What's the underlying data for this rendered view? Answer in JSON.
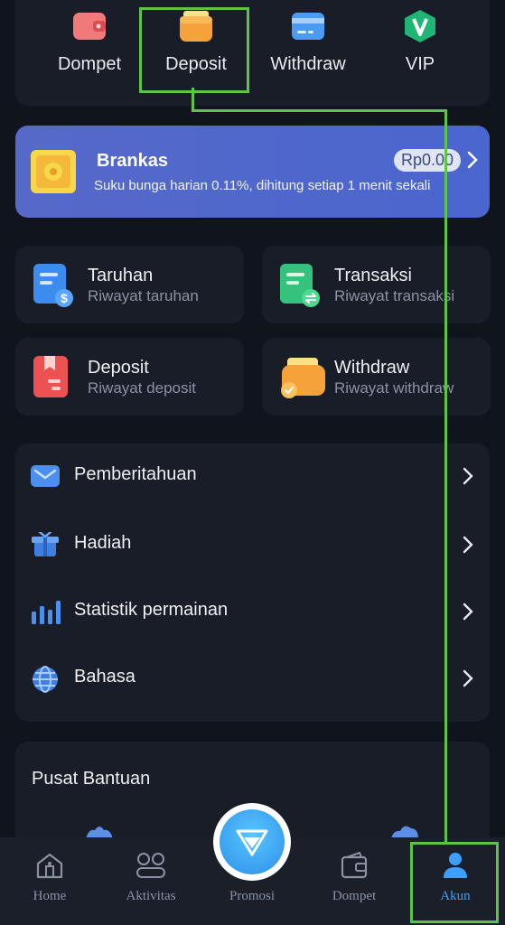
{
  "quick_actions": [
    {
      "label": "Dompet",
      "icon": "wallet-red-icon"
    },
    {
      "label": "Deposit",
      "icon": "wallet-orange-icon"
    },
    {
      "label": "Withdraw",
      "icon": "card-blue-icon"
    },
    {
      "label": "VIP",
      "icon": "vip-shield-icon"
    }
  ],
  "brankas": {
    "title": "Brankas",
    "subtitle": "Suku bunga harian 0.11%, dihitung setiap 1 menit sekali",
    "amount": "Rp0.00"
  },
  "history": [
    {
      "title": "Taruhan",
      "subtitle": "Riwayat taruhan",
      "icon": "bet-document-icon",
      "color": "#3c8cf0"
    },
    {
      "title": "Transaksi",
      "subtitle": "Riwayat transaksi",
      "icon": "transaction-document-icon",
      "color": "#35c27c"
    },
    {
      "title": "Deposit",
      "subtitle": "Riwayat deposit",
      "icon": "deposit-document-icon",
      "color": "#ee5152"
    },
    {
      "title": "Withdraw",
      "subtitle": "Riwayat withdraw",
      "icon": "withdraw-wallet-icon",
      "color": "#f5a623"
    }
  ],
  "menu": [
    {
      "label": "Pemberitahuan",
      "icon": "mail-icon"
    },
    {
      "label": "Hadiah",
      "icon": "gift-icon"
    },
    {
      "label": "Statistik permainan",
      "icon": "bar-chart-icon"
    },
    {
      "label": "Bahasa",
      "icon": "globe-icon"
    }
  ],
  "help": {
    "title": "Pusat Bantuan"
  },
  "bottom_nav": [
    {
      "label": "Home",
      "icon": "home-icon"
    },
    {
      "label": "Aktivitas",
      "icon": "activity-icon"
    },
    {
      "label": "Promosi",
      "icon": "diamond-icon"
    },
    {
      "label": "Dompet",
      "icon": "wallet-icon"
    },
    {
      "label": "Akun",
      "icon": "user-icon",
      "active": true
    }
  ],
  "colors": {
    "background": "#10141c",
    "card": "#181d27",
    "accent": "#3ba0ff",
    "brankas": "#4f67cc",
    "highlight": "#5dc447"
  }
}
